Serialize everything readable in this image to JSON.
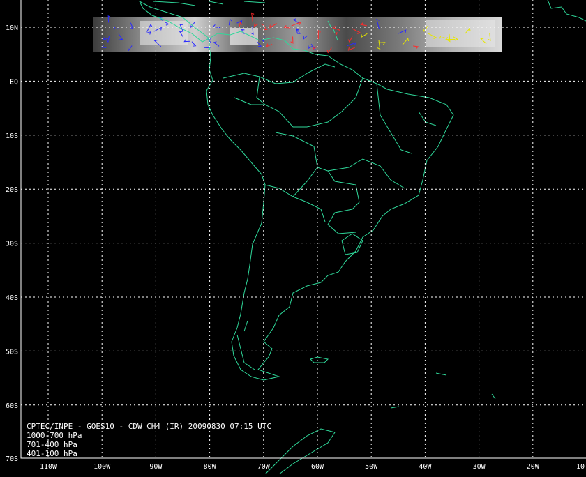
{
  "map": {
    "lat_labels": [
      "10N",
      "EQ",
      "10S",
      "20S",
      "30S",
      "40S",
      "50S",
      "60S",
      "70S"
    ],
    "lon_labels": [
      "110W",
      "100W",
      "90W",
      "80W",
      "70W",
      "60W",
      "50W",
      "40W",
      "30W",
      "20W",
      "10"
    ],
    "colors": {
      "background": "#000000",
      "coast": "#2fd89a",
      "grid": "#ffffff",
      "band_light": "#bdbdbd",
      "band_dark": "#4a4a4a"
    }
  },
  "caption": {
    "title": "CPTEC/INPE - GOES10 - CDW CH4 (IR) 20090830 07:15 UTC",
    "legend": [
      {
        "label": "1000-700 hPa",
        "color": "#ff2a2a"
      },
      {
        "label": "701-400 hPa",
        "color": "#e6e600"
      },
      {
        "label": "401-100 hPa",
        "color": "#2a2aff"
      }
    ]
  }
}
